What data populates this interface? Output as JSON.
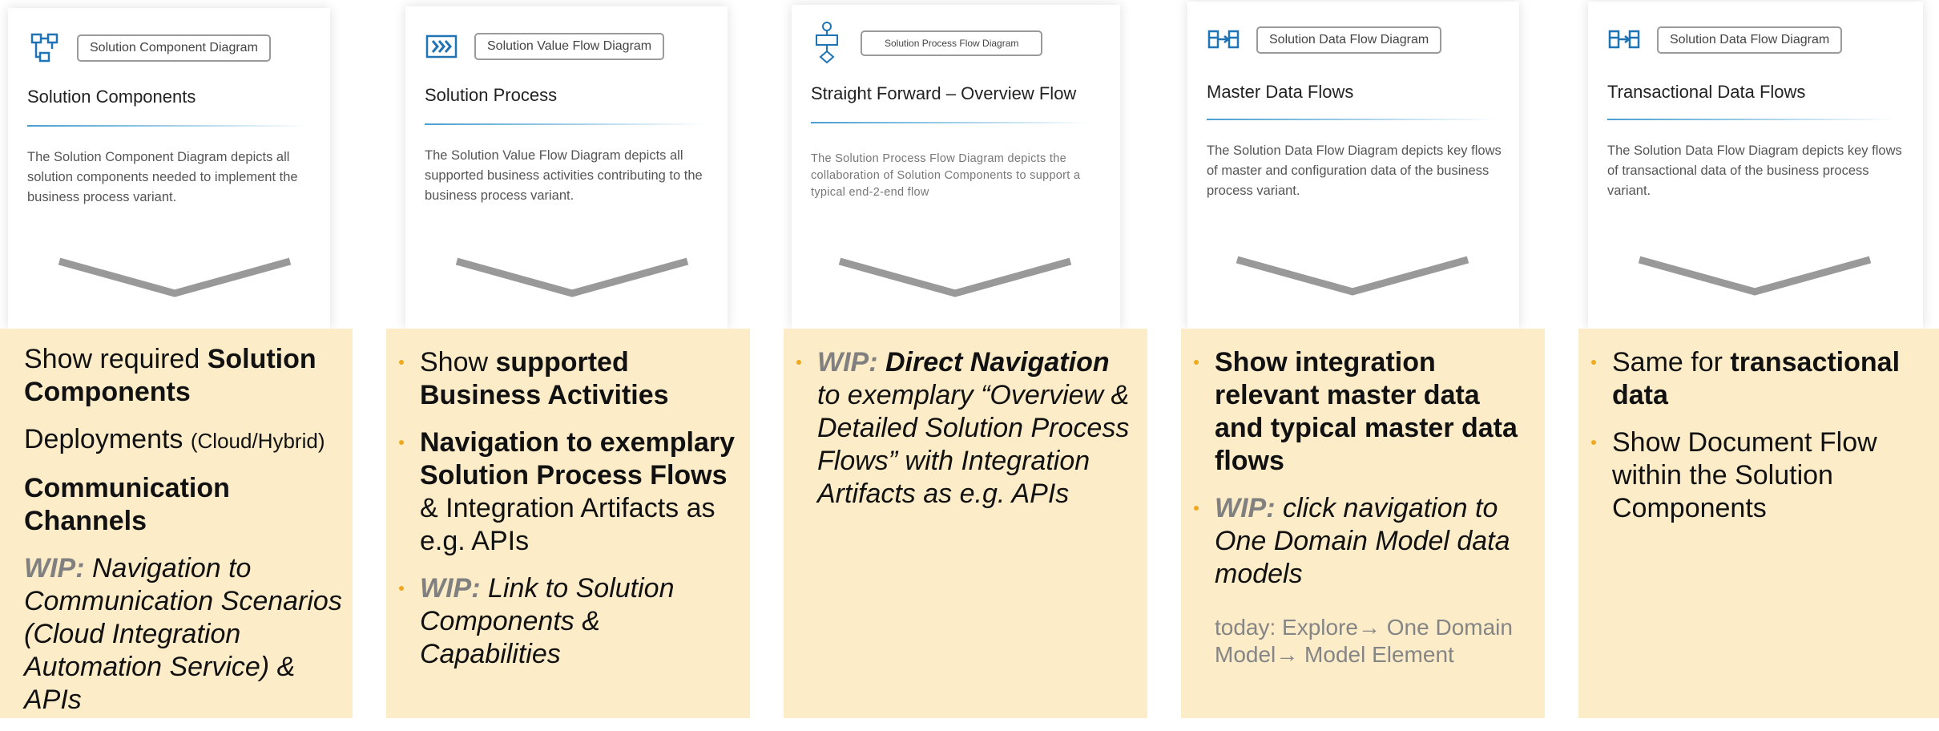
{
  "columns": [
    {
      "id": "solution-components",
      "tag": "Solution Component Diagram",
      "icon": "component-diagram-icon",
      "title": "Solution Components",
      "description": "The Solution Component Diagram depicts all solution components needed to implement the business process variant.",
      "bullets": [
        {
          "parts": [
            "Show required ",
            "Solution Components"
          ]
        },
        {
          "parts": [
            "Deployments ",
            "(Cloud/Hybrid)"
          ]
        },
        {
          "parts": [
            "Communication Channels"
          ]
        },
        {
          "parts": [
            "WIP:",
            " Navigation to Communication Scenarios (Cloud Integration Automation Service) & APIs"
          ]
        }
      ]
    },
    {
      "id": "solution-process",
      "tag": "Solution Value Flow Diagram",
      "icon": "value-flow-icon",
      "title": "Solution Process",
      "description": "The Solution Value Flow Diagram depicts all supported business activities contributing to the business process variant.",
      "bullets": [
        {
          "parts": [
            "Show ",
            "supported Business Activities"
          ]
        },
        {
          "parts": [
            "Navigation to exemplary Solution Process Flows",
            " & Integration Artifacts as e.g. APIs"
          ]
        },
        {
          "parts": [
            "WIP:",
            " Link to Solution Components & Capabilities"
          ]
        }
      ]
    },
    {
      "id": "overview-flow",
      "tag": "Solution Process Flow Diagram",
      "icon": "process-flow-icon",
      "title": "Straight Forward – Overview Flow",
      "description": "The Solution Process Flow Diagram  depicts the collaboration of Solution Components  to support a typical end-2-end flow",
      "bullets": [
        {
          "parts": [
            "WIP:",
            " Direct Navigation",
            " to  exemplary “Overview & Detailed Solution Process Flows” with Integration Artifacts as e.g. APIs"
          ]
        }
      ]
    },
    {
      "id": "master-data-flows",
      "tag": "Solution Data Flow Diagram",
      "icon": "data-flow-icon",
      "title": "Master Data Flows",
      "description": "The Solution Data Flow Diagram depicts key flows of master and configuration data of the business process variant.",
      "bullets": [
        {
          "parts": [
            "Show integration relevant master data and typical master data flows"
          ]
        },
        {
          "parts": [
            "WIP:",
            " click navigation to One Domain Model data models"
          ]
        }
      ],
      "note": {
        "prefix": "today: Explore",
        "arrow1": "→",
        "middle": " One Domain Model",
        "arrow2": "→",
        "suffix": " Model Element"
      }
    },
    {
      "id": "transactional-data-flows",
      "tag": "Solution Data Flow Diagram",
      "icon": "data-flow-icon",
      "title": "Transactional Data Flows",
      "description": "The Solution Data Flow Diagram depicts key flows of transactional data of the business process variant.",
      "bullets": [
        {
          "parts": [
            "Same for ",
            "transactional data"
          ]
        },
        {
          "parts": [
            "Show Document Flow within the Solution Components"
          ]
        }
      ]
    }
  ],
  "colors": {
    "panel": "#fdecc8",
    "bullet": "#f0a91e",
    "accent": "#4a9fd0",
    "icon_blue": "#1f74b5",
    "wip_gray": "#808080",
    "chevron": "#999999"
  }
}
